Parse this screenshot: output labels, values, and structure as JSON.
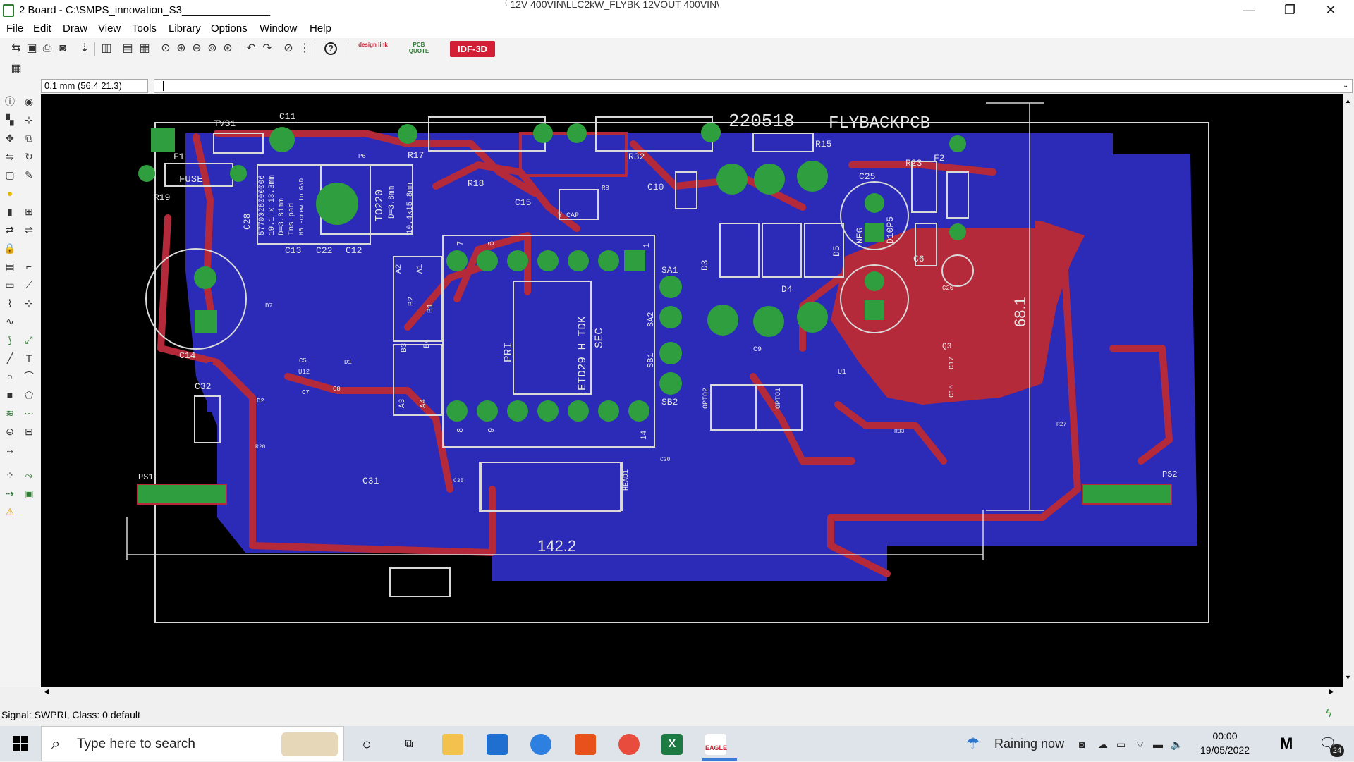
{
  "window": {
    "title": "2 Board - C:\\SMPS_innovation_S3_______________",
    "title_tail": "⁽ 12V 400VIN\\LLC2kW_FLYBK 12VOUT 400VIN\\",
    "minimize_glyph": "—",
    "restore_glyph": "❐",
    "close_glyph": "✕"
  },
  "menu": [
    "File",
    "Edit",
    "Draw",
    "View",
    "Tools",
    "Library",
    "Options",
    "Window",
    "Help"
  ],
  "toolbar": {
    "designlink_label": "design link",
    "pcbquote_label": "PCB QUOTE",
    "idf3d_label": "IDF-3D",
    "help_glyph": "?"
  },
  "coordinates": "0.1 mm (56.4 21.3)",
  "command_input": "",
  "status": "Signal: SWPRI, Class: 0 default",
  "board": {
    "date_code": "220518",
    "name": "FLYBACKPCB",
    "dim_width": "142.2",
    "dim_height": "68.1",
    "labels": [
      "TVS1",
      "C11",
      "P6",
      "R17",
      "R32",
      "R15",
      "F1",
      "FUSE",
      "R18",
      "C15",
      "Y CAP",
      "C10",
      "R23",
      "F2",
      "R19",
      "C28",
      "C25",
      "C13",
      "C22",
      "C12",
      "TO220",
      "D=3.8mm",
      "10.4x15.8mm",
      "C20",
      "C6",
      "SA1",
      "D3",
      "D4",
      "D5",
      "NEG",
      "D10P5",
      "C14",
      "ETD29 H TDK",
      "PRI",
      "SEC",
      "SA2",
      "SB1",
      "SB2",
      "C9",
      "C17",
      "C16",
      "Q3",
      "C32",
      "OPTO2",
      "OPTO1",
      "C31",
      "HEAD1",
      "PS1",
      "PS2",
      "A2",
      "A1",
      "B2",
      "B1",
      "B3",
      "B4",
      "A3",
      "A4",
      "14",
      "R8",
      "D2",
      "D1",
      "D7",
      "C5",
      "C7",
      "C8",
      "U1",
      "U12",
      "C30",
      "C35",
      "R20",
      "R27",
      "R33"
    ],
    "text_block": [
      "5770028000006",
      "19.1 x 13.3mm",
      "D=3.81mm",
      "Ins pad",
      "H6 screw to GND"
    ],
    "pin_numbers": [
      "7",
      "6",
      "1",
      "8",
      "9"
    ]
  },
  "taskbar": {
    "search_placeholder": "Type here to search",
    "weather": "Raining now",
    "time": "00:00",
    "date": "19/05/2022",
    "notifications_count": "24",
    "apps": [
      "task-view",
      "file-explorer",
      "store",
      "chat",
      "office",
      "chrome",
      "excel",
      "eagle"
    ],
    "eagle_label": "EAGLE"
  },
  "colors": {
    "top_copper": "#b52a3a",
    "bottom_copper": "#2b2bb8",
    "pad": "#2e9e3e",
    "silkscreen": "#e6e6e6",
    "canvas_bg": "#000000",
    "idf3d_bg": "#d31f35"
  }
}
